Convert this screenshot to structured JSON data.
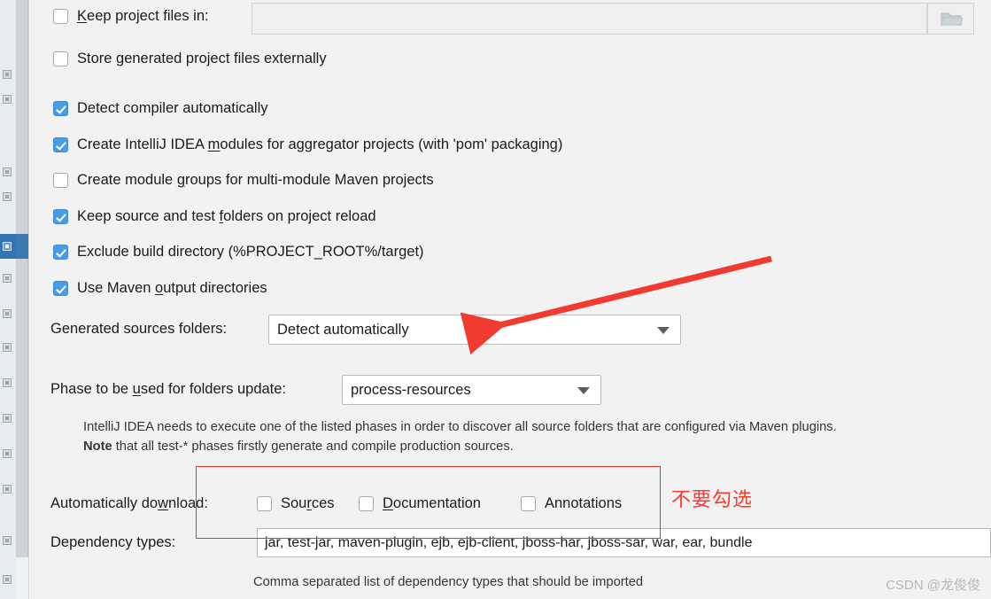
{
  "window": {
    "background_color": "#f2f2f2",
    "accent_color": "#4a9ae8",
    "annotation_color": "#fb3a30"
  },
  "settings": {
    "keep_project_files": {
      "label": "Keep project files in:",
      "label_mnemonic": "K",
      "checked": false,
      "value": "",
      "browse_icon": "folder-icon"
    },
    "store_generated_externally": {
      "label": "Store generated project files externally",
      "checked": false
    },
    "detect_compiler": {
      "label": "Detect compiler automatically",
      "checked": true
    },
    "create_modules_aggregator": {
      "label_pre": "Create IntelliJ IDEA ",
      "label_mnemonic": "m",
      "label_post": "odules for aggregator projects (with 'pom' packaging)",
      "checked": true
    },
    "create_module_groups": {
      "label_pre": "Create module ",
      "label_mnemonic": "g",
      "label_post": "roups for multi-module Maven projects",
      "checked": false
    },
    "keep_source_test_folders": {
      "label_pre": "Keep source and test ",
      "label_mnemonic": "f",
      "label_post": "olders on project reload",
      "checked": true
    },
    "exclude_build_directory": {
      "label": "Exclude build directory (%PROJECT_ROOT%/target)",
      "checked": true
    },
    "use_maven_output": {
      "label_pre": "Use Maven ",
      "label_mnemonic": "o",
      "label_post": "utput directories",
      "checked": true
    },
    "generated_sources_folders": {
      "label": "Generated sources folders:",
      "value": "Detect automatically",
      "caret_icon": "chevron-down-icon"
    },
    "phase_for_folders_update": {
      "label_pre": "Phase to be ",
      "label_mnemonic": "u",
      "label_post": "sed for folders update:",
      "value": "process-resources",
      "caret_icon": "chevron-down-icon"
    },
    "phase_help_line1": "IntelliJ IDEA needs to execute one of the listed phases in order to discover all source folders that are configured via Maven plugins.",
    "phase_help_note_bold": "Note",
    "phase_help_line2_rest": " that all test-* phases firstly generate and compile production sources.",
    "automatically_download": {
      "label_pre": "Automatically do",
      "label_mnemonic": "w",
      "label_post": "nload:",
      "options": [
        {
          "label_pre": "Sou",
          "label_mnemonic": "r",
          "label_post": "ces",
          "checked": false
        },
        {
          "label_pre": "",
          "label_mnemonic": "D",
          "label_post": "ocumentation",
          "checked": false
        },
        {
          "label_pre": "Annotations",
          "label_mnemonic": "",
          "label_post": "",
          "checked": false
        }
      ]
    },
    "dependency_types": {
      "label": "Dependency types:",
      "value": "jar, test-jar, maven-plugin, ejb, ejb-client, jboss-har, jboss-sar, war, ear, bundle",
      "help": "Comma separated list of dependency types that should be imported"
    }
  },
  "annotations": {
    "arrow_note": "red-arrow-pointing-to-generated-sources-folders",
    "box_note": "不要勾选"
  },
  "watermark": "CSDN @龙俊俊"
}
